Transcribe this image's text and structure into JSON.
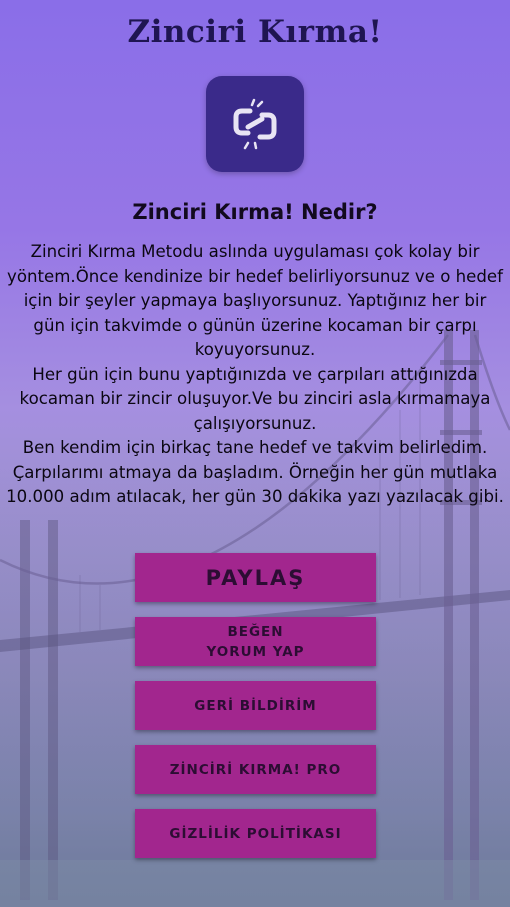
{
  "app": {
    "title": "Zinciri Kırma!"
  },
  "logo": {
    "icon": "broken-chain-icon"
  },
  "section": {
    "heading": "Zinciri Kırma! Nedir?"
  },
  "description": {
    "paragraphs": [
      "Zinciri Kırma Metodu aslında uygulaması çok kolay bir yöntem.Önce kendinize bir hedef belirliyorsunuz ve o hedef için bir şeyler yapmaya başlıyorsunuz. Yaptığınız her bir gün için takvimde o günün üzerine kocaman bir çarpı koyuyorsunuz.",
      "Her gün için bunu yaptığınızda ve çarpıları attığınızda kocaman bir zincir oluşuyor.Ve bu zinciri asla kırmamaya çalışıyorsunuz.",
      "Ben kendim için birkaç tane hedef ve takvim belirledim. Çarpılarımı atmaya da başladım. Örneğin her gün mutlaka 10.000 adım atılacak, her gün 30 dakika yazı yazılacak gibi."
    ]
  },
  "buttons": {
    "share": "PAYLAŞ",
    "like_line1": "BEĞEN",
    "like_line2": "YORUM YAP",
    "feedback": "GERİ BİLDİRİM",
    "pro": "ZİNCİRİ KIRMA! PRO",
    "privacy": "GİZLİLİK POLİTİKASI"
  },
  "colors": {
    "button_bg": "#a2268e",
    "logo_bg": "#3a2a8a",
    "title_color": "#1f1552"
  }
}
